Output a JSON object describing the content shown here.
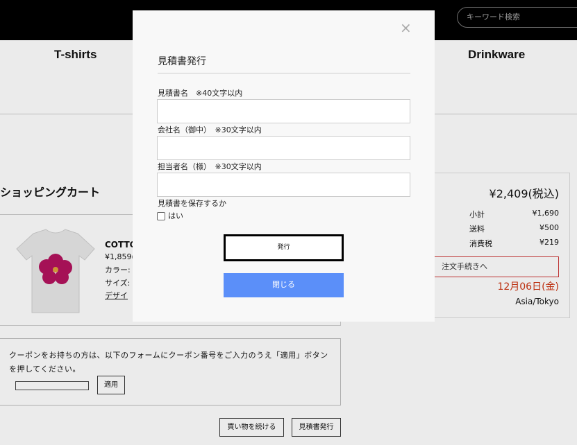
{
  "header": {
    "search_placeholder": "キーワード検索"
  },
  "nav": {
    "items": [
      "T-shirts",
      "Drinkware"
    ]
  },
  "cart": {
    "title": "ショッピングカート",
    "product": {
      "name": "COTTO",
      "price": "¥1,859(",
      "color": "カラー:",
      "size": "サイズ:",
      "design": "デザイ"
    }
  },
  "coupon": {
    "text": "クーポンをお持ちの方は、以下のフォームにクーポン番号をご入力のうえ「適用」ボタンを押してください。",
    "apply_label": "適用"
  },
  "bottom_buttons": {
    "continue_label": "買い物を続ける",
    "estimate_label": "見積書発行"
  },
  "summary": {
    "total": "¥2,409(税込)",
    "rows": [
      {
        "label": "小計",
        "value": "¥1,690"
      },
      {
        "label": "送料",
        "value": "¥500"
      },
      {
        "label": "消費税",
        "value": "¥219"
      }
    ],
    "checkout_label": "注文手続きへ",
    "date": "12月06日(金)",
    "timezone": "Asia/Tokyo"
  },
  "modal": {
    "close_glyph": "×",
    "title": "見積書発行",
    "fields": [
      {
        "label": "見積書名　※40文字以内",
        "value": ""
      },
      {
        "label": "会社名（御中）　※30文字以内",
        "value": ""
      },
      {
        "label": "担当者名（様）　※30文字以内",
        "value": ""
      }
    ],
    "save_question": "見積書を保存するか",
    "save_checkbox_label": "はい",
    "issue_label": "発行",
    "close_label": "閉じる"
  },
  "colors": {
    "close_button": "#5b8ff9",
    "date": "#cc3311",
    "checkout_border": "#cc3333"
  }
}
